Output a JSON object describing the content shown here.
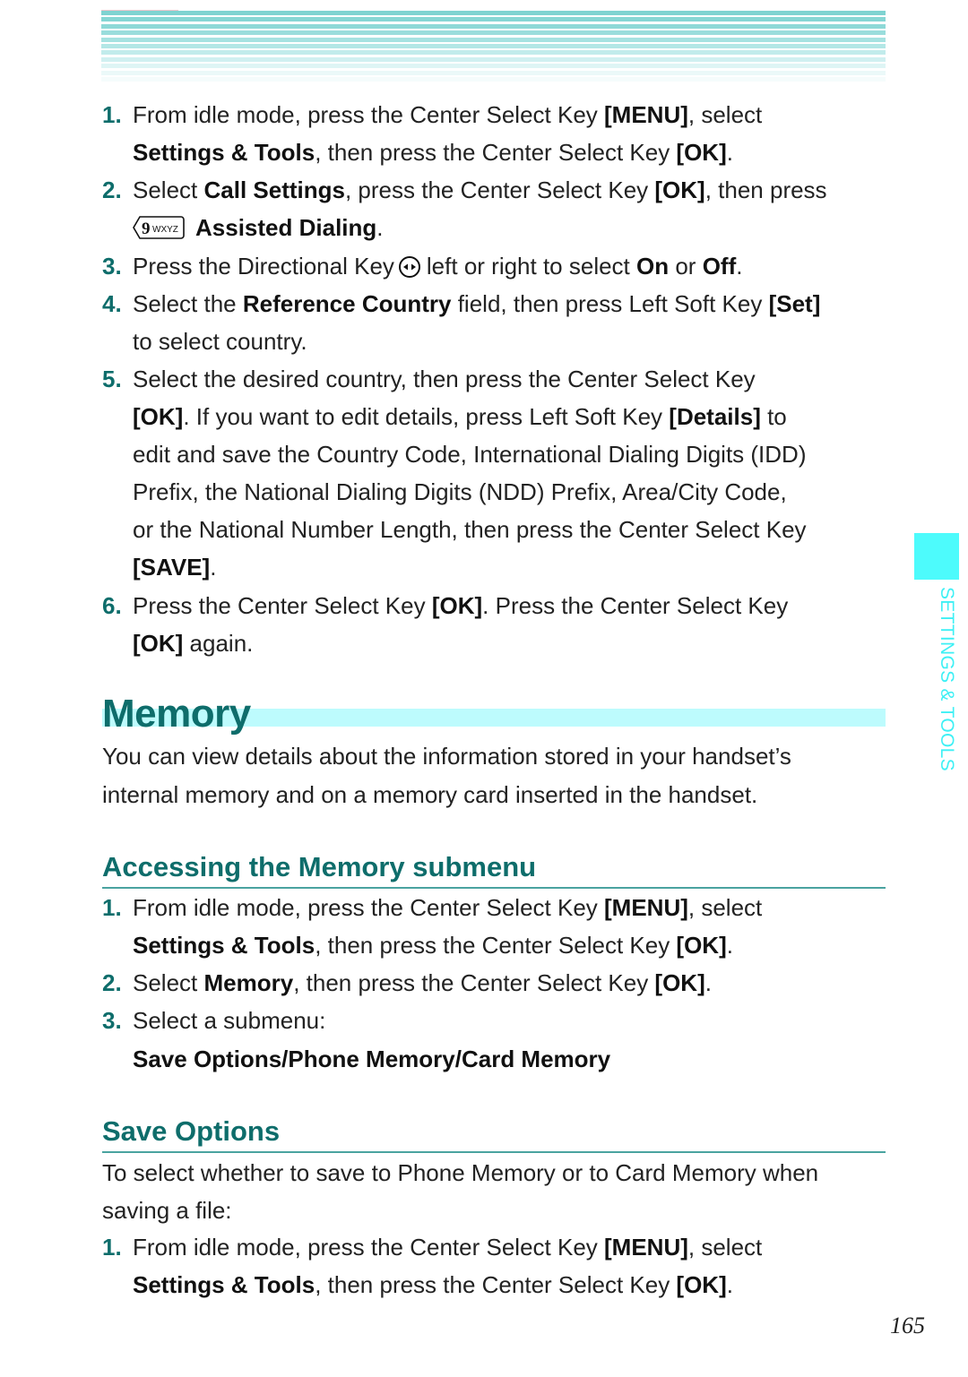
{
  "header": {
    "stripe_colors": [
      "#7fd3d1",
      "#86d6d4",
      "#8ed9d7",
      "#9adddc",
      "#a6e2e1",
      "#b3e7e6",
      "#c2ecec",
      "#d0f0f1",
      "#def5f5",
      "#ebf9f9",
      "#f5fcfc"
    ]
  },
  "section1": {
    "steps": [
      {
        "num": "1.",
        "parts": [
          {
            "t": "From idle mode, press the Center Select Key "
          },
          {
            "b": "[MENU]"
          },
          {
            "t": ", select"
          },
          {
            "br": true
          },
          {
            "b": "Settings & Tools"
          },
          {
            "t": ", then press the Center Select Key "
          },
          {
            "b": "[OK]"
          },
          {
            "t": "."
          }
        ]
      },
      {
        "num": "2.",
        "parts": [
          {
            "t": "Select "
          },
          {
            "b": "Call Settings"
          },
          {
            "t": ", press the Center Select Key "
          },
          {
            "b": "[OK]"
          },
          {
            "t": ", then press"
          },
          {
            "br": true
          },
          {
            "icon": "key-9-wxyz"
          },
          {
            "b": "Assisted Dialing"
          },
          {
            "t": "."
          }
        ]
      },
      {
        "num": "3.",
        "parts": [
          {
            "t": "Press the Directional Key"
          },
          {
            "icon": "directional-key"
          },
          {
            "t": "left or right to select "
          },
          {
            "b": "On"
          },
          {
            "t": " or "
          },
          {
            "b": "Off"
          },
          {
            "t": "."
          }
        ]
      },
      {
        "num": "4.",
        "parts": [
          {
            "t": "Select the "
          },
          {
            "b": "Reference Country"
          },
          {
            "t": " field, then press Left Soft Key "
          },
          {
            "b": "[Set]"
          },
          {
            "br": true
          },
          {
            "t": "to select country."
          }
        ]
      },
      {
        "num": "5.",
        "parts": [
          {
            "t": "Select the desired country, then press the Center Select Key"
          },
          {
            "br": true
          },
          {
            "b": "[OK]"
          },
          {
            "t": ". If you want to edit details, press Left Soft Key "
          },
          {
            "b": "[Details]"
          },
          {
            "t": " to"
          },
          {
            "br": true
          },
          {
            "t": "edit and save the Country Code, International Dialing Digits (IDD)"
          },
          {
            "br": true
          },
          {
            "t": "Prefix, the National Dialing Digits (NDD) Prefix, Area/City Code,"
          },
          {
            "br": true
          },
          {
            "t": "or the National Number Length, then press the Center Select Key"
          },
          {
            "br": true
          },
          {
            "b": "[SAVE]"
          },
          {
            "t": "."
          }
        ]
      },
      {
        "num": "6.",
        "parts": [
          {
            "t": "Press the Center Select Key "
          },
          {
            "b": "[OK]"
          },
          {
            "t": ". Press the Center Select Key"
          },
          {
            "br": true
          },
          {
            "b": "[OK]"
          },
          {
            "t": " again."
          }
        ]
      }
    ]
  },
  "memory": {
    "title": "Memory",
    "intro_line1": "You can view details about the information stored in your handset’s",
    "intro_line2": "internal memory and on a memory card inserted in the handset."
  },
  "accessing": {
    "heading": "Accessing the Memory submenu",
    "steps": [
      {
        "num": "1.",
        "parts": [
          {
            "t": "From idle mode, press the Center Select Key "
          },
          {
            "b": "[MENU]"
          },
          {
            "t": ", select"
          },
          {
            "br": true
          },
          {
            "b": "Settings & Tools"
          },
          {
            "t": ", then press the Center Select Key "
          },
          {
            "b": "[OK]"
          },
          {
            "t": "."
          }
        ]
      },
      {
        "num": "2.",
        "parts": [
          {
            "t": "Select "
          },
          {
            "b": "Memory"
          },
          {
            "t": ", then press the Center Select Key "
          },
          {
            "b": "[OK]"
          },
          {
            "t": "."
          }
        ]
      },
      {
        "num": "3.",
        "parts": [
          {
            "t": "Select a submenu:"
          }
        ]
      }
    ],
    "submenu_options": "Save Options/Phone Memory/Card Memory"
  },
  "save_options": {
    "heading": "Save Options",
    "intro_line1": "To select whether to save to Phone Memory or to Card Memory when",
    "intro_line2": "saving a file:",
    "steps": [
      {
        "num": "1.",
        "parts": [
          {
            "t": "From idle mode, press the Center Select Key "
          },
          {
            "b": "[MENU]"
          },
          {
            "t": ", select"
          },
          {
            "br": true
          },
          {
            "b": "Settings & Tools"
          },
          {
            "t": ", then press the Center Select Key "
          },
          {
            "b": "[OK]"
          },
          {
            "t": "."
          }
        ]
      }
    ]
  },
  "side_tab": {
    "label": "SETTINGS & TOOLS",
    "color": "#4dfbfc"
  },
  "page_number": "165",
  "colors": {
    "accent_teal": "#0e6d6b",
    "heading_rule": "#4aa3a0",
    "memory_band": "#bdfbfd"
  }
}
